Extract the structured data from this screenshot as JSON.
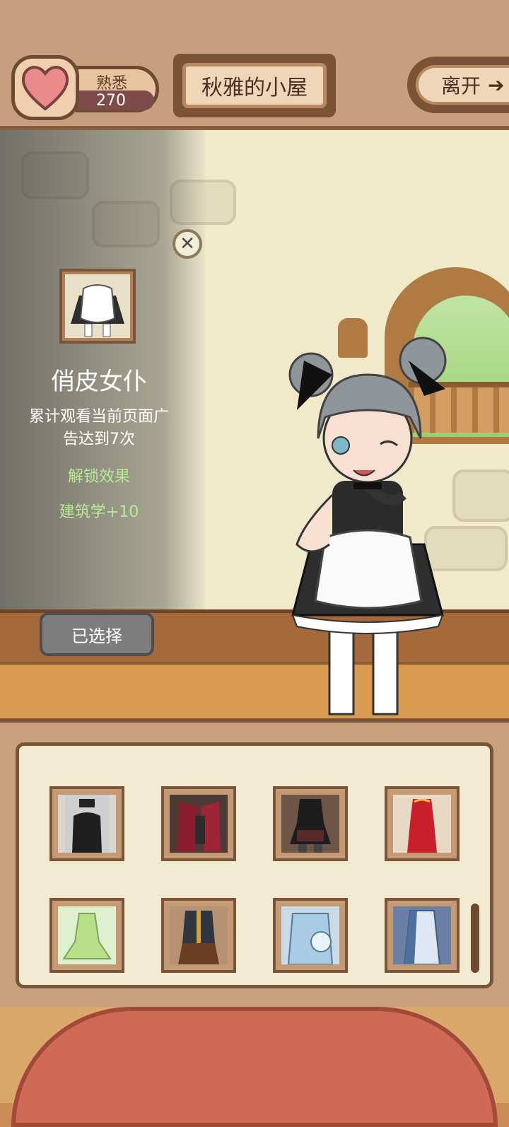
{
  "topbar": {
    "familiarity_label": "熟悉",
    "familiarity_value": "270",
    "room_title": "秋雅的小屋",
    "leave_label": "离开",
    "leave_arrow": "➔"
  },
  "info_panel": {
    "close_symbol": "✕",
    "item_name": "俏皮女仆",
    "description_line1": "累计观看当前页面广",
    "description_line2": "告达到7次",
    "unlock_label": "解锁效果",
    "unlock_effect": "建筑学+10",
    "select_button_label": "已选择"
  },
  "wardrobe": {
    "slots": [
      {
        "icon": "outfit-bunny-black"
      },
      {
        "icon": "outfit-red-jacket"
      },
      {
        "icon": "outfit-black-dress"
      },
      {
        "icon": "outfit-red-qipao"
      },
      {
        "icon": "outfit-green-fairy"
      },
      {
        "icon": "outfit-dark-coat"
      },
      {
        "icon": "outfit-light-blue"
      },
      {
        "icon": "outfit-blue-white"
      }
    ]
  },
  "colors": {
    "accent_green": "#b7eb95",
    "panel_brown": "#7a553a",
    "heart_pink": "#e98b8b"
  }
}
